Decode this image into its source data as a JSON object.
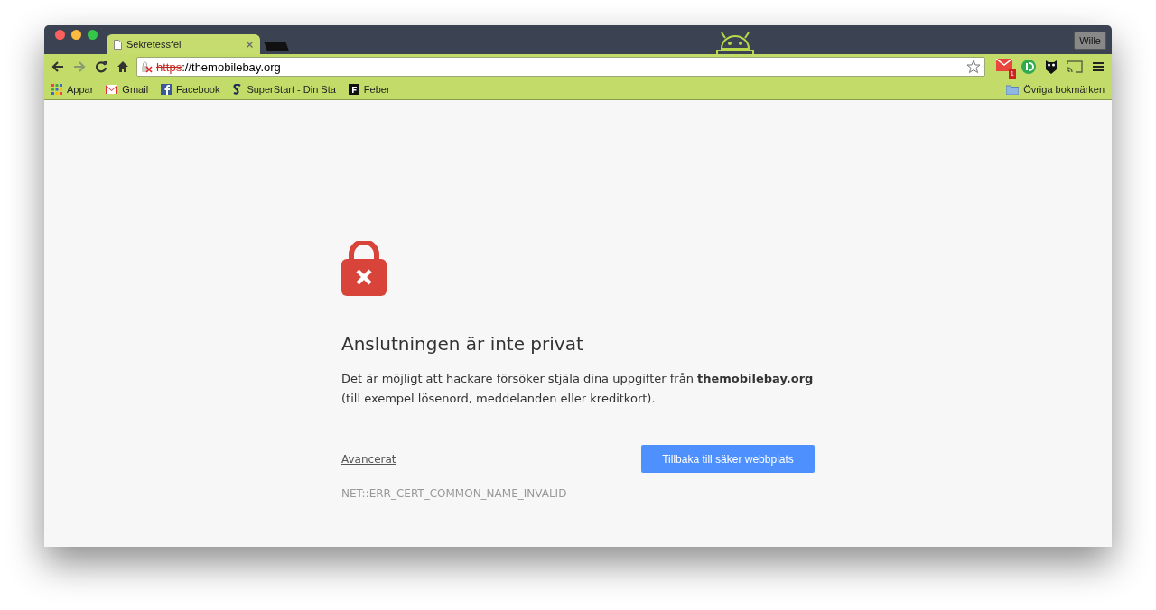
{
  "window": {
    "user": "Wille"
  },
  "tabs": [
    {
      "title": "Sekretessfel",
      "selected": true
    }
  ],
  "toolbar": {
    "url_scheme": "https",
    "url_rest": "://themobilebay.org",
    "mail_badge": "1"
  },
  "bookmarks": [
    {
      "label": "Appar",
      "kind": "apps"
    },
    {
      "label": "Gmail",
      "kind": "gmail"
    },
    {
      "label": "Facebook",
      "kind": "facebook"
    },
    {
      "label": "SuperStart - Din Sta",
      "kind": "superstart"
    },
    {
      "label": "Feber",
      "kind": "feber"
    }
  ],
  "other_bookmarks": "Övriga bokmärken",
  "error": {
    "heading": "Anslutningen är inte privat",
    "description": "Det är möjligt att hackare försöker stjäla dina uppgifter från **themobilebay.org** (till exempel lösenord, meddelanden eller kreditkort).",
    "advanced_link": "Avancerat",
    "back_button": "Tillbaka till säker webbplats",
    "code": "NET::ERR_CERT_COMMON_NAME_INVALID"
  }
}
